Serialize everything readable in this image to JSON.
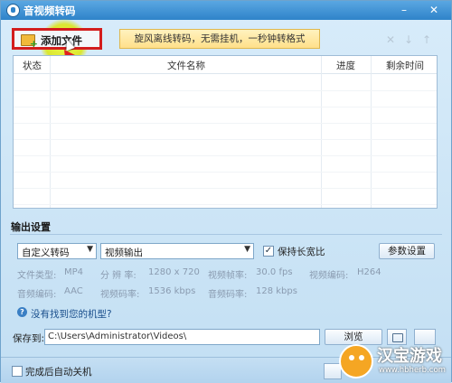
{
  "window": {
    "title": "音视频转码",
    "minimize": "–",
    "close": "✕"
  },
  "toolbar": {
    "add_file_label": "添加文件",
    "banner": "旋风离线转码，无需挂机，一秒钟转格式",
    "icons": [
      "close-icon",
      "arrow-down-icon",
      "arrow-up-icon"
    ]
  },
  "table": {
    "headers": [
      "状态",
      "文件名称",
      "进度",
      "剩余时间"
    ]
  },
  "output": {
    "section_title": "输出设置",
    "mode_select": "自定义转码",
    "output_select": "视频输出",
    "keep_ratio_label": "保持长宽比",
    "keep_ratio_checked": true,
    "settings_button": "参数设置",
    "params": {
      "file_type_label": "文件类型:",
      "file_type": "MP4",
      "resolution_label": "分 辨 率:",
      "resolution": "1280 x 720",
      "framerate_label": "视频帧率:",
      "framerate": "30.0 fps",
      "vcodec_label": "视频编码:",
      "vcodec": "H264",
      "acodec_label": "音频编码:",
      "acodec": "AAC",
      "vbitrate_label": "视频码率:",
      "vbitrate": "1536 kbps",
      "abitrate_label": "音频码率:",
      "abitrate": "128 kbps"
    },
    "help_link": "没有找到您的机型?"
  },
  "save": {
    "label": "保存到:",
    "path": "C:\\Users\\Administrator\\Videos\\",
    "browse_button": "浏览"
  },
  "footer": {
    "shutdown_label": "完成后自动关机"
  },
  "watermark": {
    "title": "汉宝游戏",
    "url": "www.hbherb.com"
  },
  "colors": {
    "highlight_border": "#d31d1d",
    "accent": "#2f83c9"
  }
}
